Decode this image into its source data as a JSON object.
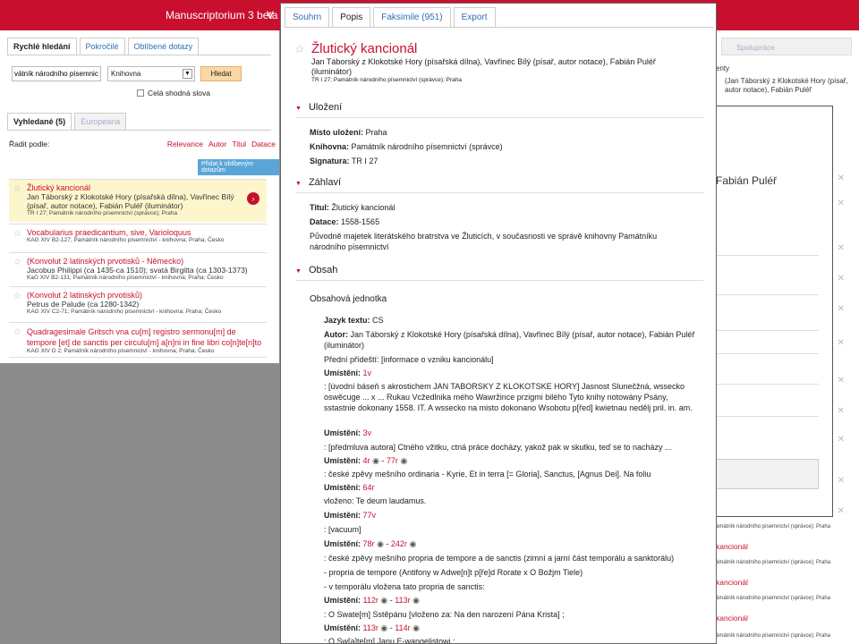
{
  "app": {
    "title": "Manuscriptorium 3 beta",
    "title_cut": "V"
  },
  "left": {
    "tabs": [
      "Rychlé hledání",
      "Pokročilé",
      "Oblíbené dotazy"
    ],
    "search_value": "vátník národního písemnictví",
    "library": "Knihovna",
    "search_button": "Hledat",
    "exact": "Celá shodná slova",
    "result_tabs": {
      "found": "Vyhledané (5)",
      "europeana": "Europeana"
    },
    "sort_label": "Řadit podle:",
    "sort": [
      "Relevance",
      "Autor",
      "Titul",
      "Datace"
    ],
    "fav_button": "Přidat k oblíbeným dotazům",
    "results": [
      {
        "title": "Žlutický kancionál",
        "author": "Jan Táborský z Klokotské Hory (písařská dílna), Vavřinec Bílý (písař, autor notace), Fabián Puléř (iluminátor)",
        "sig": "TR I 27; Památník národního písemnictví (správce); Praha"
      },
      {
        "title": "Vocabularius praedicantium, sive, Varioloquus",
        "author": "",
        "sig": "KAG XIV B2-127; Památník národního písemnictví - knihovna; Praha; Česko"
      },
      {
        "title": "(Konvolut 2 latinských prvotisků - Německo)",
        "author": "Jacobus Philippi (ca 1435-ca 1510); svatá Birgitta (ca 1303-1373)",
        "sig": "KaG XIV B2-131; Památník národního písemnictví - knihovna; Praha; Česko"
      },
      {
        "title": "(Konvolut 2 latinských prvotisků)",
        "author": "Petrus de Palude (ca 1280-1342)",
        "sig": "KAG XIV C2-71; Památník národního písemnictví - knihovna; Praha; Česko"
      },
      {
        "title": "Quadragesimale Gritsch vna cu[m] registro sermonu[m] de tempore [et] de sanctis per circulu[m] a[n]ni in fine libri co[n]te[n]to",
        "author": "",
        "sig": "KAG XIV D 2; Památník národního písemnictví - knihovna; Praha; Česko"
      }
    ]
  },
  "modal": {
    "tabs": [
      "Souhrn",
      "Popis",
      "Faksimile (951)",
      "Export"
    ],
    "title": "Žlutický kancionál",
    "authors": "Jan Táborský z Klokotské Hory (písařská dílna), Vavřinec Bílý (písař, autor notace), Fabián Puléř (iluminátor)",
    "sig": "TR I 27; Památník národního písemnictví (správce); Praha",
    "s1": "Uložení",
    "misto_l": "Místo uložení:",
    "misto": "Praha",
    "knih_l": "Knihovna:",
    "knih": "Památník národního písemnictví (správce)",
    "sign_l": "Signatura:",
    "sign": "TR I 27",
    "s2": "Záhlaví",
    "titul_l": "Titul:",
    "titul": "Žlutický kancionál",
    "dat_l": "Datace:",
    "dat": "1558-1565",
    "puvod": "Původně majetek literátského bratrstva ve Žluticích, v současnosti ve správě knihovny Památníku národního písemnictví",
    "s3": "Obsah",
    "unit": "Obsahová jednotka",
    "jazyk_l": "Jazyk textu:",
    "jazyk": "CS",
    "autor_l": "Autor:",
    "autor": "Jan Táborský z Klokotské Hory (písařská dílna), Vavřinec Bílý (písař, autor notace), Fabián Puléř (iluminátor)",
    "predni": "Přední přídeští: [informace o vzniku kancionálu]",
    "um": "Umístění:",
    "u1": "1v",
    "t1": ": [úvodní báseň s akrostichem JAN TABORSKY Z KLOKOTSKE HORY] Jasnost Slunečžná, wssecko oswěcuge ... x ... Rukau Vcžedlnika mého Wawržince przigmi bilého Tyto knihy notowány Psány, sstastnie dokonany 1558. IT. A wssecko na misto dokonano Wsobotu p[řed] kwietnau nedělj pril. in. am.",
    "u2": "3v",
    "t2": ": [předmluva autora] Ctného vžitku, ctná práce docházy, yakož pak w skutku, teď se to nacházy ...",
    "u3": "4r",
    "u3b": "77r",
    "t3": ": české zpěvy mešního ordinaria - Kyrie, Et in terra [= Gloria], Sanctus, [Agnus Dei]. Na foliu",
    "u4": "64r",
    "t4": "vloženo: Te deum laudamus.",
    "u5": "77v",
    "t5": ": [vacuum]",
    "u6": "78r",
    "u6b": "242r",
    "t6": ": české zpěvy mešního propria de tempore a de sanctis (zimní a jarní část temporálu a sanktorálu)",
    "t6b": "- propria de tempore (Antifony w Adwe[n]t p[ře]d Rorate x O Božjm Tiele)",
    "t6c": "- v temporálu vložena tato propria de sanctis:",
    "u7": "112r",
    "u7b": "113r",
    "t7": ": O Swate[m] Sstěpánu [vloženo za: Na den narození Pána Krista] ;",
    "u8": "113r",
    "u8b": "114r",
    "t8": ": O Sw[a]te[m] Janu E-wangelistowi ;"
  },
  "right": {
    "tab": "Spolupráce",
    "frag1": "enty",
    "frag2": "(Jan Táborský z Klokotské Hory (písař, autor notace), Fabián Puléř",
    "name": "Fabián Puléř",
    "sub": "ámátník národního písemnictví (správce); Praha",
    "red": "kancionál"
  }
}
